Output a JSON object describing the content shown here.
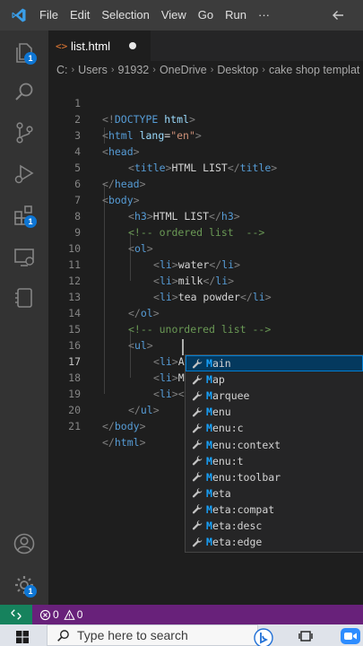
{
  "titlebar": {
    "menu": [
      "File",
      "Edit",
      "Selection",
      "View",
      "Go",
      "Run",
      "···"
    ]
  },
  "activitybar": {
    "explorer_badge": "1",
    "extensions_badge": "1",
    "manage_badge": "1"
  },
  "tab": {
    "label": "list.html",
    "icon": "<>"
  },
  "breadcrumb": [
    "C:",
    "Users",
    "91932",
    "OneDrive",
    "Desktop",
    "cake shop templat"
  ],
  "editor": {
    "active_line": 17,
    "lines": [
      {
        "no": "1"
      },
      {
        "no": "2"
      },
      {
        "no": "3"
      },
      {
        "no": "4"
      },
      {
        "no": "5"
      },
      {
        "no": "6"
      },
      {
        "no": "7"
      },
      {
        "no": "8"
      },
      {
        "no": "9"
      },
      {
        "no": "10"
      },
      {
        "no": "11"
      },
      {
        "no": "12"
      },
      {
        "no": "13"
      },
      {
        "no": "14"
      },
      {
        "no": "15"
      },
      {
        "no": "16"
      },
      {
        "no": "17"
      },
      {
        "no": "18"
      },
      {
        "no": "19"
      },
      {
        "no": "20"
      },
      {
        "no": "21"
      }
    ],
    "tokens": {
      "l1": [
        "<!",
        "DOCTYPE",
        " html",
        ">"
      ],
      "l2": [
        "<",
        "html",
        " lang",
        "=",
        "\"en\"",
        ">"
      ],
      "l3": [
        "<",
        "head",
        ">"
      ],
      "l4": [
        "<",
        "title",
        ">",
        "HTML LIST",
        "</",
        "title",
        ">"
      ],
      "l5": [
        "</",
        "head",
        ">"
      ],
      "l6": [
        "<",
        "body",
        ">"
      ],
      "l7": [
        "<",
        "h3",
        ">",
        "HTML LIST",
        "</",
        "h3",
        ">"
      ],
      "l8": "<!-- ordered list  -->",
      "l9": [
        "<",
        "ol",
        ">"
      ],
      "l10": [
        "<",
        "li",
        ">",
        "water",
        "</",
        "li",
        ">"
      ],
      "l11": [
        "<",
        "li",
        ">",
        "milk",
        "</",
        "li",
        ">"
      ],
      "l12": [
        "<",
        "li",
        ">",
        "tea powder",
        "</",
        "li",
        ">"
      ],
      "l13": [
        "</",
        "ol",
        ">"
      ],
      "l14": "<!-- unordered list -->",
      "l15": [
        "<",
        "ul",
        ">"
      ],
      "l16": [
        "<",
        "li",
        ">",
        "Apple",
        "</",
        "li",
        ">"
      ],
      "l17": [
        "<",
        "li",
        ">",
        "M",
        "</",
        "li",
        ">"
      ],
      "l18": [
        "<",
        "li",
        ">",
        "<"
      ],
      "l19": [
        "</",
        "ul",
        ">"
      ],
      "l20": [
        "</",
        "body",
        ">"
      ],
      "l21": [
        "</",
        "html",
        ">"
      ]
    }
  },
  "suggest": {
    "items": [
      {
        "hl": "M",
        "rest": "ain"
      },
      {
        "hl": "M",
        "rest": "ap"
      },
      {
        "hl": "M",
        "rest": "arquee"
      },
      {
        "hl": "M",
        "rest": "enu"
      },
      {
        "hl": "M",
        "rest": "enu:c"
      },
      {
        "hl": "M",
        "rest": "enu:context"
      },
      {
        "hl": "M",
        "rest": "enu:t"
      },
      {
        "hl": "M",
        "rest": "enu:toolbar"
      },
      {
        "hl": "M",
        "rest": "eta"
      },
      {
        "hl": "M",
        "rest": "eta:compat"
      },
      {
        "hl": "M",
        "rest": "eta:desc"
      },
      {
        "hl": "M",
        "rest": "eta:edge"
      }
    ],
    "selected_index": 0,
    "icon": "wrench-icon"
  },
  "statusbar": {
    "errors": "0",
    "warnings": "0"
  },
  "taskbar": {
    "search_placeholder": "Type here to search"
  },
  "colors": {
    "accent": "#007acc",
    "statusbar": "#68217a",
    "remote": "#16825d",
    "tag": "#569cd6",
    "attribute": "#9cdcfe",
    "string": "#ce9178",
    "comment": "#6a9955",
    "badge": "#0e76d4"
  }
}
